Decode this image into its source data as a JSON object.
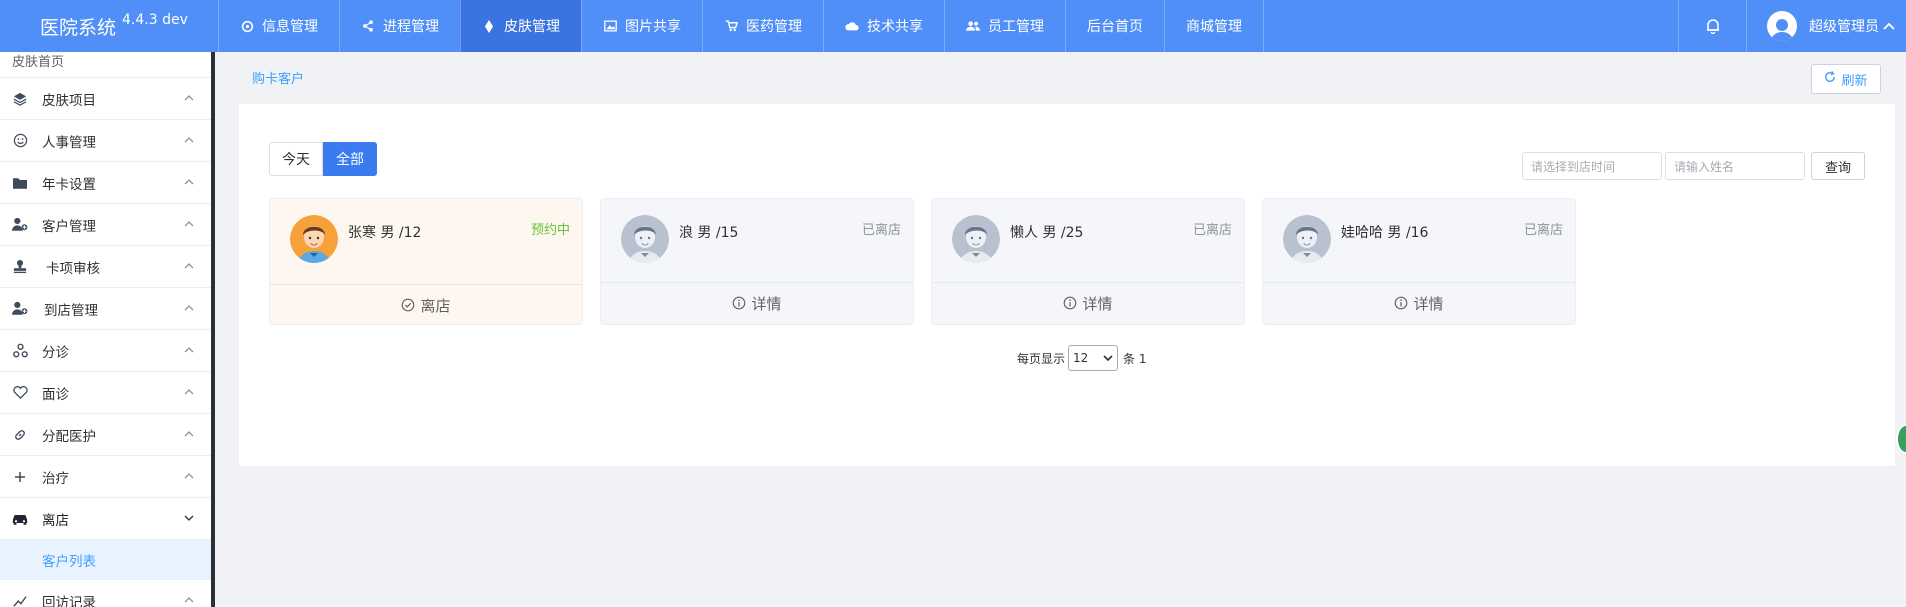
{
  "brand": {
    "title": "医院系统",
    "version": "4.4.3 dev"
  },
  "nav": [
    {
      "label": "信息管理",
      "icon": "settings-icon"
    },
    {
      "label": "进程管理",
      "icon": "share-icon"
    },
    {
      "label": "皮肤管理",
      "icon": "diamond-icon",
      "active": true
    },
    {
      "label": "图片共享",
      "icon": "image-icon"
    },
    {
      "label": "医药管理",
      "icon": "cart-icon"
    },
    {
      "label": "技术共享",
      "icon": "cloud-icon"
    },
    {
      "label": "员工管理",
      "icon": "users-icon"
    },
    {
      "label": "后台首页",
      "icon": ""
    },
    {
      "label": "商城管理",
      "icon": ""
    }
  ],
  "user": {
    "name": "超级管理员"
  },
  "sidebar": {
    "home": "皮肤首页",
    "items": [
      {
        "label": "皮肤项目",
        "icon": "layers-icon"
      },
      {
        "label": "人事管理",
        "icon": "smile-icon"
      },
      {
        "label": "年卡设置",
        "icon": "folder-icon"
      },
      {
        "label": "客户管理",
        "icon": "user-add-icon"
      },
      {
        "label": "卡项审核",
        "icon": "stamp-icon"
      },
      {
        "label": "到店管理",
        "icon": "user-add-icon"
      },
      {
        "label": "分诊",
        "icon": "triage-icon"
      },
      {
        "label": "面诊",
        "icon": "heart-icon"
      },
      {
        "label": "分配医护",
        "icon": "link-icon"
      },
      {
        "label": "治疗",
        "icon": "plus-icon"
      },
      {
        "label": "离店",
        "icon": "car-icon",
        "open": true
      },
      {
        "label": "回访记录",
        "icon": "chart-icon"
      }
    ],
    "sub_item": "客户列表"
  },
  "breadcrumb": "购卡客户",
  "refresh_label": "刷新",
  "segments": {
    "today": "今天",
    "all": "全部"
  },
  "filters": {
    "date_placeholder": "请选择到店时间",
    "name_placeholder": "请输入姓名",
    "query_label": "查询"
  },
  "cards": [
    {
      "name": "张寒 男 /12",
      "status": "预约中",
      "action": "离店",
      "action_icon": "check-circle-icon",
      "highlight": true
    },
    {
      "name": "浪 男 /15",
      "status": "已离店",
      "action": "详情",
      "action_icon": "info-icon"
    },
    {
      "name": "懒人 男 /25",
      "status": "已离店",
      "action": "详情",
      "action_icon": "info-icon"
    },
    {
      "name": "娃哈哈 男 /16",
      "status": "已离店",
      "action": "详情",
      "action_icon": "info-icon"
    }
  ],
  "pager": {
    "per_page_label": "每页显示",
    "per_page": "12",
    "total_label": "条 1"
  },
  "colors": {
    "topbar": "#4f8ff7",
    "active_nav": "#3a74e0",
    "primary": "#409eff",
    "success": "#67c23a"
  }
}
